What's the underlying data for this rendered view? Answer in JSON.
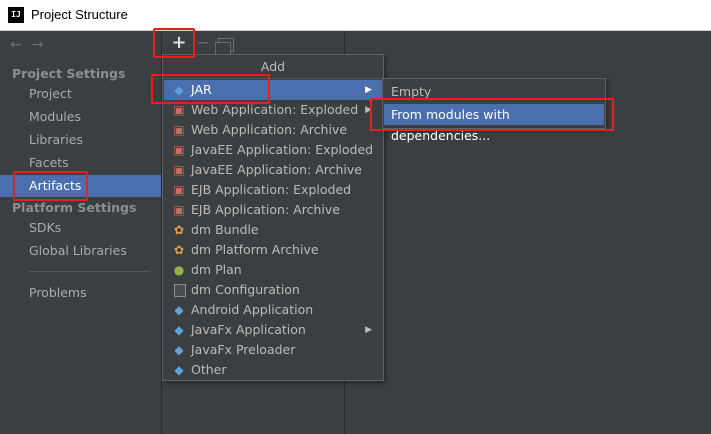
{
  "window": {
    "title": "Project Structure",
    "app_icon": "IJ"
  },
  "sidebar": {
    "nav": {
      "back": "←",
      "forward": "→"
    },
    "project_settings_header": "Project Settings",
    "project_settings": [
      "Project",
      "Modules",
      "Libraries",
      "Facets",
      "Artifacts"
    ],
    "selected": "Artifacts",
    "platform_settings_header": "Platform Settings",
    "platform_settings": [
      "SDKs",
      "Global Libraries"
    ],
    "other": [
      "Problems"
    ]
  },
  "toolbar": {
    "add": "+",
    "remove": "−"
  },
  "add_menu": {
    "header": "Add",
    "items": [
      {
        "label": "JAR",
        "icon": "diamond-icon",
        "submenu": true
      },
      {
        "label": "Web Application: Exploded",
        "icon": "web-app-icon",
        "submenu": true
      },
      {
        "label": "Web Application: Archive",
        "icon": "web-app-icon"
      },
      {
        "label": "JavaEE Application: Exploded",
        "icon": "javaee-icon"
      },
      {
        "label": "JavaEE Application: Archive",
        "icon": "javaee-icon"
      },
      {
        "label": "EJB Application: Exploded",
        "icon": "ejb-icon"
      },
      {
        "label": "EJB Application: Archive",
        "icon": "ejb-icon"
      },
      {
        "label": "dm Bundle",
        "icon": "bundle-icon"
      },
      {
        "label": "dm Platform Archive",
        "icon": "bundle-icon"
      },
      {
        "label": "dm Plan",
        "icon": "plan-icon"
      },
      {
        "label": "dm Configuration",
        "icon": "config-icon"
      },
      {
        "label": "Android Application",
        "icon": "diamond-icon"
      },
      {
        "label": "JavaFx Application",
        "icon": "diamond-icon",
        "submenu": true
      },
      {
        "label": "JavaFx Preloader",
        "icon": "diamond-icon"
      },
      {
        "label": "Other",
        "icon": "diamond-icon"
      }
    ],
    "selected": "JAR"
  },
  "jar_submenu": {
    "items": [
      "Empty",
      "From modules with dependencies..."
    ],
    "selected": "From modules with dependencies..."
  },
  "colors": {
    "selection": "#4b6eaf",
    "highlight_box": "#e8201d",
    "background": "#3c3f41"
  }
}
